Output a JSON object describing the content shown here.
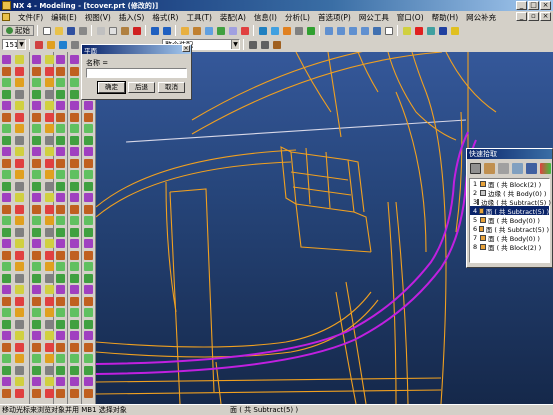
{
  "window": {
    "title": "NX 4 - Modeling - [tcover.prt (修改的)]"
  },
  "menus": [
    "文件(F)",
    "编辑(E)",
    "视图(V)",
    "插入(S)",
    "格式(R)",
    "工具(T)",
    "装配(A)",
    "信息(I)",
    "分析(L)",
    "首选项(P)",
    "窗口(O)",
    "网公工具",
    "窗口(O)",
    "帮助(H)",
    "网公补充"
  ],
  "toolbar": {
    "start_label": "起始",
    "layer_value": "151",
    "filter_value": "整个装配"
  },
  "name_dialog": {
    "title": "平面",
    "name_label": "名称 =",
    "name_value": "",
    "ok_label": "确定",
    "back_label": "后退",
    "cancel_label": "取消"
  },
  "quick_pick": {
    "title": "快速拾取",
    "items": [
      {
        "num": "1",
        "label": "面 ( 共 Block(2) )",
        "color": "#e8a23a",
        "selected": false
      },
      {
        "num": "2",
        "label": "边缘 ( 共 Body(0) )",
        "color": "#c8c8c8",
        "selected": false
      },
      {
        "num": "3",
        "label": "边缘 ( 共 Subtract(5) )",
        "color": "#c8c8c8",
        "selected": false
      },
      {
        "num": "4",
        "label": "面 ( 共 Subtract(5) )",
        "color": "#e8a23a",
        "selected": true
      },
      {
        "num": "5",
        "label": "面 ( 共 Body(0) )",
        "color": "#e8a23a",
        "selected": false
      },
      {
        "num": "6",
        "label": "面 ( 共 Subtract(5) )",
        "color": "#e8a23a",
        "selected": false
      },
      {
        "num": "7",
        "label": "面 ( 共 Body(0) )",
        "color": "#e8a23a",
        "selected": false
      },
      {
        "num": "8",
        "label": "面 ( 共 Block(2) )",
        "color": "#e8a23a",
        "selected": false
      }
    ]
  },
  "status": {
    "prompt": "移动光标来浏览对象并用 MB1 选择对象",
    "selection": "面 ( 共 Subtract(5) )"
  },
  "colors": {
    "wire_orange": "#f0a020",
    "wire_magenta": "#c020e0",
    "wire_white": "#d8d8e8",
    "selection_blue": "#0a246a"
  }
}
